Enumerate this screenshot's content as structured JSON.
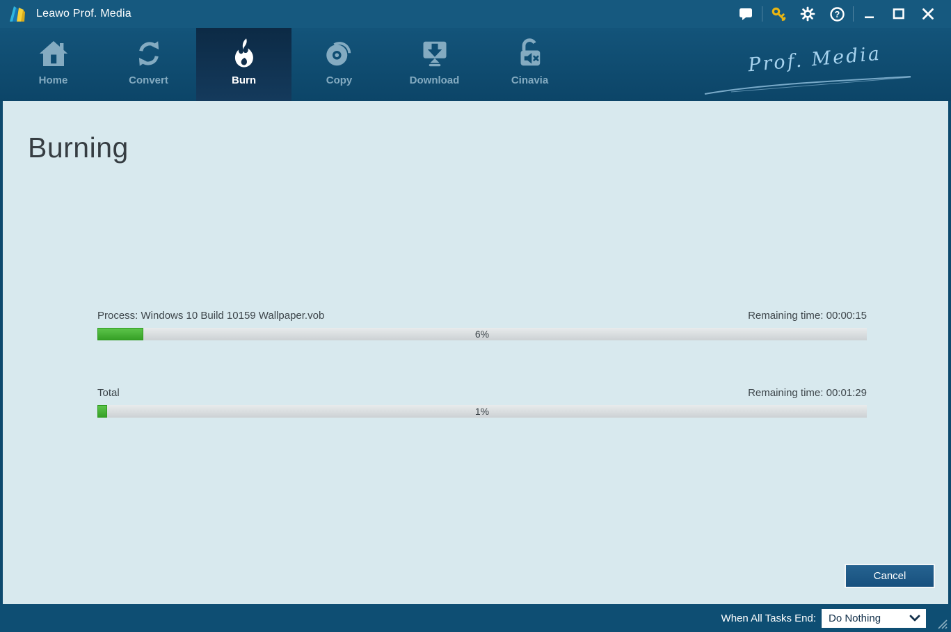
{
  "window": {
    "title": "Leawo Prof. Media",
    "titlebar_icons": [
      "message-icon",
      "key-icon",
      "gear-icon",
      "help-icon",
      "minimize-icon",
      "maximize-icon",
      "close-icon"
    ],
    "key_icon_color": "#e8b512",
    "titlebar_color": "#16597f"
  },
  "nav": {
    "tabs": [
      {
        "label": "Home",
        "icon": "home-icon",
        "active": false
      },
      {
        "label": "Convert",
        "icon": "convert-icon",
        "active": false
      },
      {
        "label": "Burn",
        "icon": "burn-flame-icon",
        "active": true
      },
      {
        "label": "Copy",
        "icon": "copy-disc-icon",
        "active": false
      },
      {
        "label": "Download",
        "icon": "download-icon",
        "active": false
      },
      {
        "label": "Cinavia",
        "icon": "cinavia-lock-icon",
        "active": false
      }
    ],
    "brand_script": "Prof. Media",
    "active_tab_color": "#112f4c"
  },
  "main": {
    "heading": "Burning",
    "tasks": [
      {
        "label": "Process: Windows 10 Build 10159 Wallpaper.vob",
        "remaining_label": "Remaining time: 00:00:15",
        "percent": 6,
        "percent_label": "6%"
      },
      {
        "label": "Total",
        "remaining_label": "Remaining time: 00:01:29",
        "percent": 1,
        "percent_label": "1%"
      }
    ],
    "progress_color": "#46b434",
    "cancel_label": "Cancel"
  },
  "footer": {
    "when_tasks_end_label": "When All Tasks End:",
    "selected_option": "Do Nothing"
  }
}
